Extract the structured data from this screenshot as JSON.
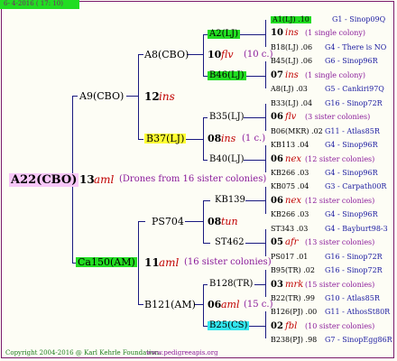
{
  "header": {
    "date": "6- 4-2016 ( 17: 10)"
  },
  "root": {
    "id": "A22(CBO)",
    "num": "13",
    "ins": "aml",
    "note": "(Drones from 16 sister colonies)"
  },
  "g1": [
    {
      "id": "A9(CBO)",
      "num": "12",
      "ins": "ins"
    },
    {
      "id": "Ca150(AM)",
      "num": "11",
      "ins": "aml",
      "note": "(16 sister colonies)"
    }
  ],
  "g2": [
    {
      "id": "A8(CBO)",
      "num": "10",
      "ins": "flv",
      "note": "(10 c.)"
    },
    {
      "id": "B37(LJ)",
      "num": "08",
      "ins": "ins",
      "note": "(1 c.)"
    },
    {
      "id": "PS704",
      "num": "08",
      "ins": "tun"
    },
    {
      "id": "B121(AM)",
      "num": "06",
      "ins": "aml",
      "note": "(15 c.)"
    }
  ],
  "g3": [
    {
      "id": "A2(LJ)"
    },
    {
      "id": "B46(LJ)"
    },
    {
      "id": "B35(LJ)"
    },
    {
      "id": "B40(LJ)"
    },
    {
      "id": "KB139"
    },
    {
      "id": "ST462"
    },
    {
      "id": "B128(TR)"
    },
    {
      "id": "B25(CS)"
    }
  ],
  "g4": [
    {
      "a": "A1(LJ) .10",
      "b": "G1 - Sinop09Q"
    },
    {
      "num": "10",
      "ins": "ins",
      "note": "(1 single colony)"
    },
    {
      "a": "B18(LJ) .06",
      "b": "G4 - There is NO"
    },
    {
      "a": "B45(LJ) .06",
      "b": "G6 - Sinop96R"
    },
    {
      "num": "07",
      "ins": "ins",
      "note": "(1 single colony)"
    },
    {
      "a": "A8(LJ) .03",
      "b": "G5 - Cankiri97Q"
    },
    {
      "a": "B33(LJ) .04",
      "b": "G16 - Sinop72R"
    },
    {
      "num": "06",
      "ins": "flv",
      "note": "(3 sister colonies)"
    },
    {
      "a": "B06(MKR) .02",
      "b": "G11 - Atlas85R"
    },
    {
      "a": "KB113 .04",
      "b": "G4 - Sinop96R"
    },
    {
      "num": "06",
      "ins": "nex",
      "note": "(12 sister colonies)"
    },
    {
      "a": "KB266 .03",
      "b": "G4 - Sinop96R"
    },
    {
      "a": "KB075 .04",
      "b": "G3 - Carpath00R"
    },
    {
      "num": "06",
      "ins": "nex",
      "note": "(12 sister colonies)"
    },
    {
      "a": "KB266 .03",
      "b": "G4 - Sinop96R"
    },
    {
      "a": "ST343 .03",
      "b": "G4 - Bayburt98-3"
    },
    {
      "num": "05",
      "ins": "afr",
      "note": "(13 sister colonies)"
    },
    {
      "a": "PS017 .01",
      "b": "G16 - Sinop72R"
    },
    {
      "a": "B95(TR) .02",
      "b": "G16 - Sinop72R"
    },
    {
      "num": "03",
      "ins": "mrk",
      "note": "(15 sister colonies)"
    },
    {
      "a": "B22(TR) .99",
      "b": "G10 - Atlas85R"
    },
    {
      "a": "B126(PJ) .00",
      "b": "G11 - AthosSt80R"
    },
    {
      "num": "02",
      "ins": "fbl",
      "note": "(10 sister colonies)"
    },
    {
      "a": "B238(PJ) .98",
      "b": "G7 - SinopEgg86R"
    }
  ],
  "footer": {
    "copyright": "Copyright 2004-2016 @ Karl Kehrle Foundation.",
    "url": "www.pedigreeapis.org"
  }
}
